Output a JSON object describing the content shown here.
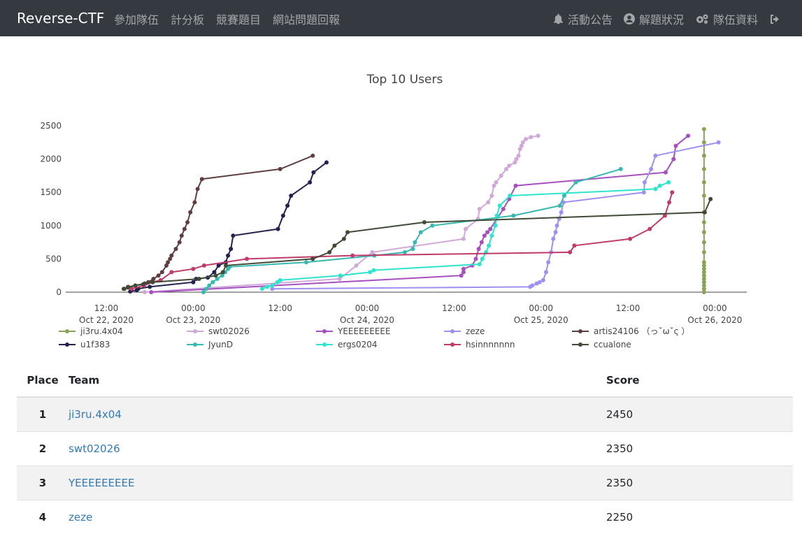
{
  "navbar": {
    "brand": "Reverse-CTF",
    "left_items": [
      "參加隊伍",
      "計分板",
      "競賽題目",
      "網站問題回報"
    ],
    "right_items": [
      {
        "label": "活動公告",
        "icon": "bell-icon"
      },
      {
        "label": "解題狀況",
        "icon": "user-circle-icon"
      },
      {
        "label": "隊伍資料",
        "icon": "cogs-icon"
      },
      {
        "label": "",
        "icon": "logout-icon"
      }
    ]
  },
  "chart_data": {
    "type": "line",
    "title": "Top 10 Users",
    "x_ticks": [
      {
        "t": 12,
        "l1": "12:00",
        "l2": "Oct 22, 2020"
      },
      {
        "t": 24,
        "l1": "00:00",
        "l2": "Oct 23, 2020"
      },
      {
        "t": 36,
        "l1": "12:00",
        "l2": ""
      },
      {
        "t": 48,
        "l1": "00:00",
        "l2": "Oct 24, 2020"
      },
      {
        "t": 60,
        "l1": "12:00",
        "l2": ""
      },
      {
        "t": 72,
        "l1": "00:00",
        "l2": "Oct 25, 2020"
      },
      {
        "t": 84,
        "l1": "12:00",
        "l2": ""
      },
      {
        "t": 96,
        "l1": "00:00",
        "l2": "Oct 26, 2020"
      }
    ],
    "xlim": [
      6.4,
      100.4
    ],
    "ylim": [
      0,
      2500
    ],
    "y_ticks": [
      0,
      500,
      1000,
      1500,
      2000,
      2500
    ],
    "series": [
      {
        "name": "ji3ru.4x04",
        "color": "#8aa35a",
        "points": [
          [
            94.5,
            0
          ],
          [
            94.5,
            50
          ],
          [
            94.5,
            100
          ],
          [
            94.5,
            150
          ],
          [
            94.5,
            200
          ],
          [
            94.5,
            250
          ],
          [
            94.5,
            300
          ],
          [
            94.5,
            350
          ],
          [
            94.5,
            400
          ],
          [
            94.5,
            450
          ],
          [
            94.5,
            600
          ],
          [
            94.5,
            750
          ],
          [
            94.5,
            900
          ],
          [
            94.5,
            1050
          ],
          [
            94.5,
            1200
          ],
          [
            94.5,
            1450
          ],
          [
            94.5,
            1650
          ],
          [
            94.5,
            1850
          ],
          [
            94.5,
            2050
          ],
          [
            94.5,
            2250
          ],
          [
            94.5,
            2450
          ]
        ]
      },
      {
        "name": "swt02026",
        "color": "#d0a9d8",
        "points": [
          [
            17.3,
            0
          ],
          [
            44.2,
            200
          ],
          [
            46.5,
            400
          ],
          [
            48.7,
            600
          ],
          [
            61.3,
            800
          ],
          [
            61.6,
            950
          ],
          [
            63.3,
            1100
          ],
          [
            63.5,
            1250
          ],
          [
            64.7,
            1350
          ],
          [
            65.2,
            1450
          ],
          [
            65.5,
            1600
          ],
          [
            65.8,
            1650
          ],
          [
            66.5,
            1750
          ],
          [
            67.2,
            1850
          ],
          [
            67.6,
            1900
          ],
          [
            68.4,
            1950
          ],
          [
            68.6,
            2000
          ],
          [
            68.9,
            2050
          ],
          [
            69.1,
            2150
          ],
          [
            69.3,
            2200
          ],
          [
            69.5,
            2250
          ],
          [
            69.9,
            2300
          ],
          [
            70.6,
            2330
          ],
          [
            71.6,
            2350
          ]
        ]
      },
      {
        "name": "YEEEEEEEEE",
        "color": "#a64fbf",
        "points": [
          [
            18.2,
            0
          ],
          [
            61.0,
            250
          ],
          [
            61.3,
            300
          ],
          [
            61.3,
            350
          ],
          [
            62.5,
            400
          ],
          [
            63.0,
            500
          ],
          [
            63.4,
            650
          ],
          [
            63.8,
            750
          ],
          [
            64.2,
            850
          ],
          [
            64.6,
            900
          ],
          [
            65.0,
            950
          ],
          [
            66.8,
            1250
          ],
          [
            67.6,
            1400
          ],
          [
            68.5,
            1600
          ],
          [
            89.2,
            1800
          ],
          [
            90.3,
            2000
          ],
          [
            90.6,
            2200
          ],
          [
            92.3,
            2350
          ]
        ]
      },
      {
        "name": "zeze",
        "color": "#9d90f0",
        "points": [
          [
            34.9,
            50
          ],
          [
            70.5,
            80
          ],
          [
            70.8,
            100
          ],
          [
            71.4,
            130
          ],
          [
            71.8,
            150
          ],
          [
            72.3,
            180
          ],
          [
            72.7,
            300
          ],
          [
            73.0,
            450
          ],
          [
            73.4,
            600
          ],
          [
            73.7,
            800
          ],
          [
            74.0,
            900
          ],
          [
            74.2,
            1000
          ],
          [
            74.5,
            1100
          ],
          [
            74.8,
            1200
          ],
          [
            75.1,
            1350
          ],
          [
            86.2,
            1500
          ],
          [
            86.3,
            1650
          ],
          [
            87.2,
            1850
          ],
          [
            87.8,
            2050
          ],
          [
            96.5,
            2250
          ]
        ]
      },
      {
        "name": "artis24106 （っ˘ω˘ς ）",
        "color": "#5e3f40",
        "points": [
          [
            14.5,
            50
          ],
          [
            15.0,
            80
          ],
          [
            16.0,
            100
          ],
          [
            17.3,
            130
          ],
          [
            17.8,
            150
          ],
          [
            18.5,
            200
          ],
          [
            19.2,
            250
          ],
          [
            19.7,
            300
          ],
          [
            20.3,
            400
          ],
          [
            20.5,
            450
          ],
          [
            20.8,
            500
          ],
          [
            21.0,
            550
          ],
          [
            21.6,
            650
          ],
          [
            22.1,
            750
          ],
          [
            22.4,
            850
          ],
          [
            22.8,
            950
          ],
          [
            23.2,
            1050
          ],
          [
            23.6,
            1200
          ],
          [
            24.2,
            1350
          ],
          [
            24.6,
            1550
          ],
          [
            25.2,
            1700
          ],
          [
            36.0,
            1850
          ],
          [
            40.5,
            2050
          ]
        ]
      },
      {
        "name": "u1f383",
        "color": "#25214d",
        "points": [
          [
            15.3,
            10
          ],
          [
            16.2,
            30
          ],
          [
            16.4,
            50
          ],
          [
            18.0,
            80
          ],
          [
            24.0,
            150
          ],
          [
            24.4,
            200
          ],
          [
            26.0,
            220
          ],
          [
            26.9,
            300
          ],
          [
            27.5,
            400
          ],
          [
            28.5,
            450
          ],
          [
            28.8,
            550
          ],
          [
            29.2,
            650
          ],
          [
            29.5,
            850
          ],
          [
            35.7,
            950
          ],
          [
            36.4,
            1150
          ],
          [
            37.0,
            1300
          ],
          [
            37.5,
            1450
          ],
          [
            40.1,
            1650
          ],
          [
            40.6,
            1800
          ],
          [
            42.4,
            1950
          ]
        ]
      },
      {
        "name": "JyunD",
        "color": "#39b8b0",
        "points": [
          [
            25.4,
            0
          ],
          [
            25.8,
            50
          ],
          [
            26.2,
            100
          ],
          [
            26.7,
            150
          ],
          [
            27.3,
            200
          ],
          [
            28.0,
            250
          ],
          [
            28.4,
            300
          ],
          [
            28.8,
            350
          ],
          [
            29.0,
            380
          ],
          [
            39.6,
            450
          ],
          [
            49.0,
            550
          ],
          [
            53.2,
            600
          ],
          [
            54.3,
            650
          ],
          [
            54.6,
            750
          ],
          [
            55.4,
            900
          ],
          [
            57.0,
            1000
          ],
          [
            68.2,
            1150
          ],
          [
            74.6,
            1300
          ],
          [
            75.2,
            1450
          ],
          [
            76.8,
            1650
          ],
          [
            83.0,
            1850
          ]
        ]
      },
      {
        "name": "ergs0204",
        "color": "#2ee4cc",
        "points": [
          [
            33.5,
            50
          ],
          [
            34.2,
            80
          ],
          [
            34.9,
            100
          ],
          [
            35.6,
            150
          ],
          [
            36.0,
            180
          ],
          [
            44.3,
            250
          ],
          [
            48.4,
            300
          ],
          [
            48.9,
            330
          ],
          [
            63.5,
            420
          ],
          [
            63.9,
            500
          ],
          [
            64.4,
            600
          ],
          [
            64.8,
            700
          ],
          [
            65.2,
            850
          ],
          [
            65.7,
            1000
          ],
          [
            65.9,
            1150
          ],
          [
            66.3,
            1300
          ],
          [
            67.7,
            1450
          ],
          [
            87.8,
            1550
          ],
          [
            88.4,
            1600
          ],
          [
            89.6,
            1650
          ]
        ]
      },
      {
        "name": "hsinnnnnnn",
        "color": "#c03b6b",
        "points": [
          [
            15.5,
            50
          ],
          [
            17.2,
            100
          ],
          [
            18.4,
            150
          ],
          [
            19.5,
            180
          ],
          [
            21.0,
            300
          ],
          [
            24.0,
            350
          ],
          [
            25.5,
            400
          ],
          [
            31.4,
            500
          ],
          [
            46.0,
            550
          ],
          [
            76.0,
            600
          ],
          [
            76.6,
            700
          ],
          [
            84.3,
            800
          ],
          [
            87.0,
            950
          ],
          [
            89.1,
            1150
          ],
          [
            89.7,
            1350
          ],
          [
            90.1,
            1500
          ]
        ]
      },
      {
        "name": "ccualone",
        "color": "#404a37",
        "points": [
          [
            14.4,
            50
          ],
          [
            15.0,
            70
          ],
          [
            16.0,
            100
          ],
          [
            17.1,
            120
          ],
          [
            18.4,
            150
          ],
          [
            24.8,
            200
          ],
          [
            27.1,
            250
          ],
          [
            28.1,
            300
          ],
          [
            28.5,
            400
          ],
          [
            40.5,
            500
          ],
          [
            42.8,
            600
          ],
          [
            43.5,
            700
          ],
          [
            44.8,
            800
          ],
          [
            45.3,
            900
          ],
          [
            55.9,
            1050
          ],
          [
            94.6,
            1200
          ],
          [
            95.4,
            1400
          ]
        ]
      }
    ]
  },
  "table": {
    "headers": [
      "Place",
      "Team",
      "Score"
    ],
    "rows": [
      {
        "place": "1",
        "team": "ji3ru.4x04",
        "score": "2450"
      },
      {
        "place": "2",
        "team": "swt02026",
        "score": "2350"
      },
      {
        "place": "3",
        "team": "YEEEEEEEEE",
        "score": "2350"
      },
      {
        "place": "4",
        "team": "zeze",
        "score": "2250"
      }
    ]
  }
}
